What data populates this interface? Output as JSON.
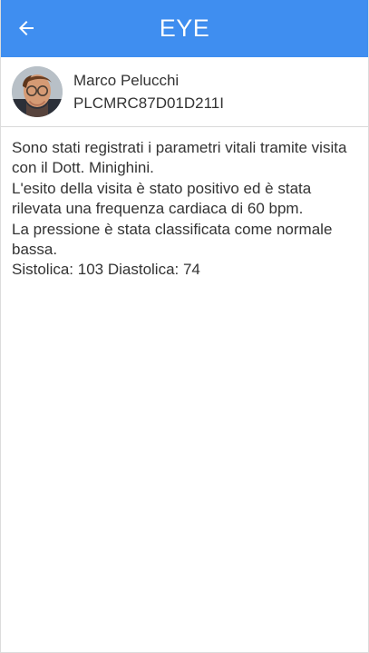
{
  "app": {
    "title": "EYE",
    "brand_color": "#3f8ef0"
  },
  "patient": {
    "name": "Marco Pelucchi",
    "fiscal_code": "PLCMRC87D01D211I"
  },
  "report": {
    "lines": [
      "Sono stati registrati i parametri vitali tramite visita con il Dott. Minighini.",
      "L'esito della visita è stato positivo ed è stata rilevata una frequenza cardiaca di 60 bpm.",
      "La pressione è stata classificata come normale bassa.",
      "Sistolica: 103 Diastolica: 74"
    ]
  },
  "icons": {
    "back": "arrow-left-icon",
    "avatar": "avatar"
  }
}
